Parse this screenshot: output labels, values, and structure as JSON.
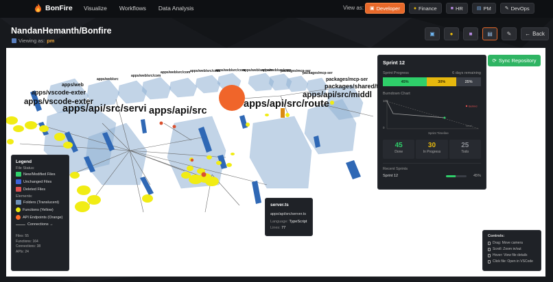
{
  "app": {
    "name": "BonFire"
  },
  "nav": {
    "links": [
      "Visualize",
      "Workflows",
      "Data Analysis"
    ]
  },
  "view_as": {
    "label": "View as:",
    "roles": [
      {
        "icon": "developer-icon",
        "label": "Developer",
        "active": true
      },
      {
        "icon": "finance-icon",
        "label": "Finance",
        "active": false
      },
      {
        "icon": "hr-icon",
        "label": "HR",
        "active": false
      },
      {
        "icon": "pm-icon",
        "label": "PM",
        "active": false
      },
      {
        "icon": "devops-icon",
        "label": "DevOps",
        "active": false
      }
    ]
  },
  "header": {
    "repo": "NandanHemanth/Bonfire",
    "viewing_prefix": "Viewing as:",
    "viewing_role": "pm",
    "back": "Back"
  },
  "sync": {
    "label": "Sync Repository"
  },
  "graph_labels": {
    "big": [
      "apps/api/src/servi",
      "apps/api/src",
      "apps/api/src/route",
      "apps/vscode-exter",
      "apps/api/src/middl"
    ],
    "medium": [
      "apps/vscode-exter",
      "apps/web",
      "packages/shared/t",
      "packages/mcp-ser"
    ],
    "small": [
      "apps/web/src",
      "apps/web/src/com",
      "apps/web/src/com",
      "apps/web/src/com",
      "apps/web/src/com",
      "apps/web/src/com",
      "apps/web/src/com",
      "packages/mcp-ser",
      "packages/mcp-ser"
    ]
  },
  "sprint": {
    "title": "Sprint 12",
    "progress_label": "Sprint Progress",
    "remaining": "6 days remaining",
    "segments": [
      {
        "label": "45%",
        "value": 0.45,
        "kind": "done"
      },
      {
        "label": "30%",
        "value": 0.3,
        "kind": "prog"
      },
      {
        "label": "25%",
        "value": 0.25,
        "kind": "todo"
      }
    ],
    "burndown_label": "Burndown Chart",
    "burndown": {
      "y_ticks": [
        "100",
        "0"
      ],
      "x_label": "Sprint Timeline",
      "legend_behind": "Behind",
      "legend_ideal": "Ideal"
    },
    "stats": [
      {
        "value": "45",
        "label": "Done",
        "color": "#2fcf6a"
      },
      {
        "value": "30",
        "label": "In Progress",
        "color": "#e6b80e"
      },
      {
        "value": "25",
        "label": "Todo",
        "color": "#8a8d93"
      }
    ],
    "recent_label": "Recent Sprints",
    "recent": [
      {
        "name": "Sprint 12",
        "pct": "45%",
        "value": 0.45
      }
    ]
  },
  "legend": {
    "title": "Legend",
    "file_status_label": "File Status:",
    "file_status": [
      {
        "label": "New/Modified Files",
        "color": "#2fcf6a"
      },
      {
        "label": "Unchanged Files",
        "color": "#3f63d9"
      },
      {
        "label": "Deleted Files",
        "color": "#e05050"
      }
    ],
    "elements_label": "Elements:",
    "elements": [
      {
        "label": "Folders (Translucent)",
        "color": "#8aa8c8"
      },
      {
        "label": "Functions (Yellow)",
        "color": "#e6e60e"
      },
      {
        "label": "API Endpoints (Orange)",
        "color": "#ff6a2a"
      }
    ],
    "connections": "Connections →",
    "stats": [
      "Files: 55",
      "Functions: 164",
      "Connections: 38",
      "APIs: 24"
    ]
  },
  "tooltip": {
    "name": "server.ts",
    "path": "apps/api/src/server.ts",
    "language_key": "Language:",
    "language": "TypeScript",
    "lines_key": "Lines:",
    "lines": "77"
  },
  "controls": {
    "title": "Controls:",
    "items": [
      "Drag: Move camera",
      "Scroll: Zoom in/out",
      "Hover: View file details",
      "Click file: Open in VSCode"
    ]
  }
}
